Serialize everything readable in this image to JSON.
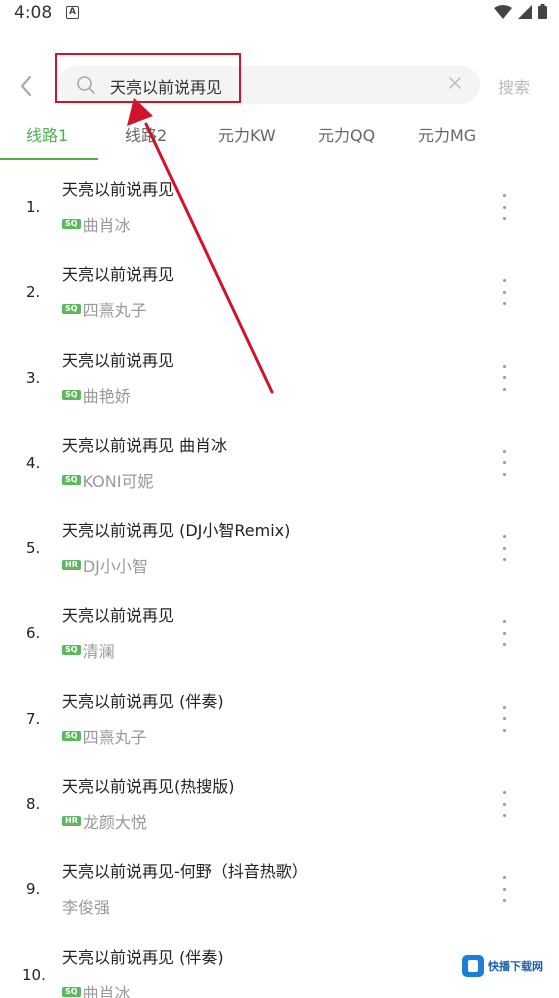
{
  "status_bar": {
    "time": "4:08",
    "notification_letter": "A"
  },
  "search": {
    "query": "天亮以前说再见",
    "button_label": "搜索"
  },
  "tabs": [
    {
      "label": "线路1",
      "active": true
    },
    {
      "label": "线路2",
      "active": false
    },
    {
      "label": "元力KW",
      "active": false
    },
    {
      "label": "元力QQ",
      "active": false
    },
    {
      "label": "元力MG",
      "active": false
    }
  ],
  "songs": [
    {
      "num": "1.",
      "title": "天亮以前说再见",
      "badge": "SQ",
      "artist": "曲肖冰"
    },
    {
      "num": "2.",
      "title": "天亮以前说再见",
      "badge": "SQ",
      "artist": "四熹丸子"
    },
    {
      "num": "3.",
      "title": "天亮以前说再见",
      "badge": "SQ",
      "artist": "曲艳娇"
    },
    {
      "num": "4.",
      "title": "天亮以前说再见 曲肖冰",
      "badge": "SQ",
      "artist": "KONI可妮"
    },
    {
      "num": "5.",
      "title": "天亮以前说再见 (DJ小智Remix)",
      "badge": "HR",
      "artist": "DJ小小智"
    },
    {
      "num": "6.",
      "title": "天亮以前说再见",
      "badge": "SQ",
      "artist": "清澜"
    },
    {
      "num": "7.",
      "title": "天亮以前说再见 (伴奏)",
      "badge": "SQ",
      "artist": "四熹丸子"
    },
    {
      "num": "8.",
      "title": "天亮以前说再见(热搜版)",
      "badge": "HR",
      "artist": "龙颜大悦"
    },
    {
      "num": "9.",
      "title": "天亮以前说再见-何野（抖音热歌）",
      "badge": "",
      "artist": "李俊强"
    },
    {
      "num": "10.",
      "title": "天亮以前说再见 (伴奏)",
      "badge": "SQ",
      "artist": "曲肖冰"
    }
  ],
  "watermark": {
    "text": "快播下载网"
  },
  "colors": {
    "accent": "#4caf50",
    "annotation": "#d0132a"
  }
}
